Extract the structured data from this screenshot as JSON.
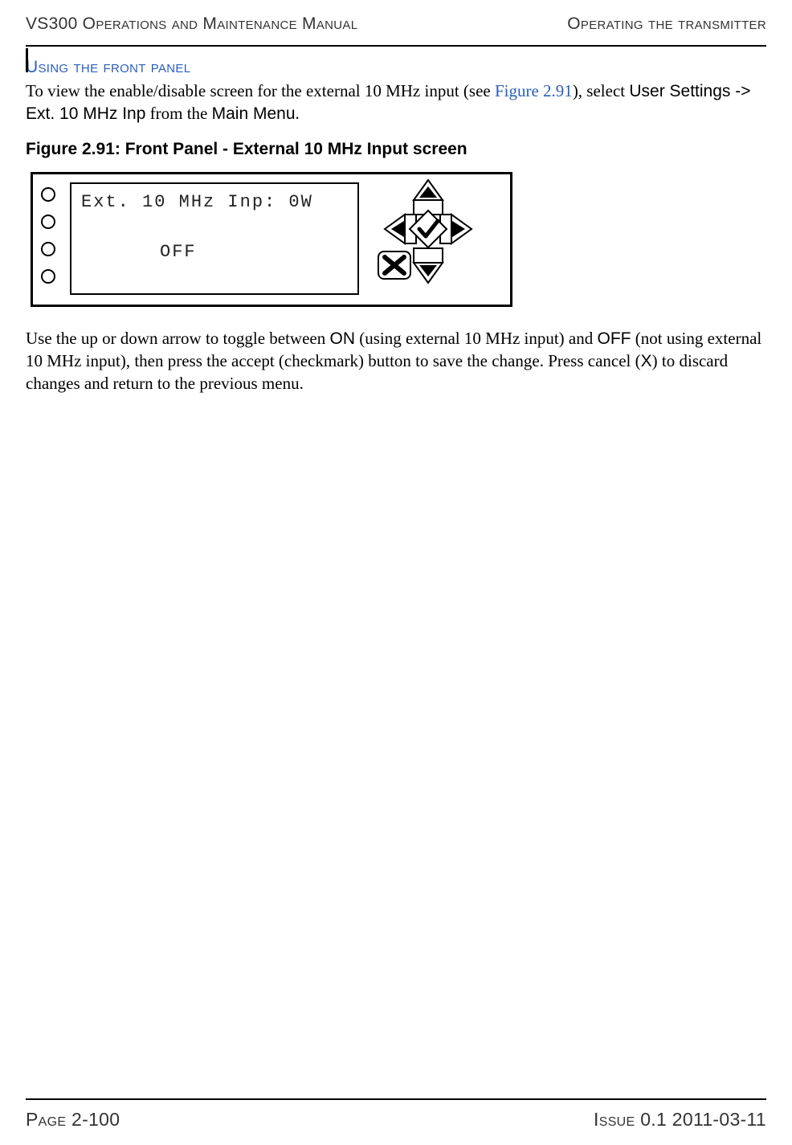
{
  "header": {
    "left": "VS300 Operations and Maintenance Manual",
    "right": "Operating the transmitter"
  },
  "section_heading": "Using the front panel",
  "intro": {
    "pre": "To view the enable/disable screen for the external 10 MHz input (see ",
    "figref": "Figure 2.91",
    "post1": "), select ",
    "ui1": "User Settings -> Ext. 10 MHz Inp",
    "post2": " from the ",
    "ui2": "Main Menu",
    "post3": "."
  },
  "figure_caption": "Figure 2.91: Front Panel - External 10 MHz Input screen",
  "lcd": {
    "line1": "Ext. 10 MHz Inp:   0W",
    "line2": "OFF"
  },
  "body": {
    "p1a": "Use the up or down arrow to toggle between ",
    "on": "ON",
    "p1b": " (using external 10 MHz input) and ",
    "off": "OFF",
    "p1c": " (not using external 10 MHz input), then press the accept (checkmark) button to save the change. Press cancel (",
    "x": "X",
    "p1d": ") to discard changes and return to the previous menu."
  },
  "footer": {
    "left": "Page 2-100",
    "right": "Issue 0.1  2011-03-11"
  }
}
